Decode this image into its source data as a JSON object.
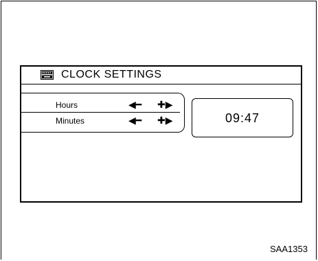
{
  "screen": {
    "title": "CLOCK SETTINGS",
    "header_icon": "keyboard-icon"
  },
  "settings": [
    {
      "label": "Hours",
      "decrease_label": "◀━",
      "increase_label": "✚▶"
    },
    {
      "label": "Minutes",
      "decrease_label": "◀━",
      "increase_label": "✚▶"
    }
  ],
  "time_display": {
    "value": "09:47"
  },
  "figure_code": "SAA1353"
}
